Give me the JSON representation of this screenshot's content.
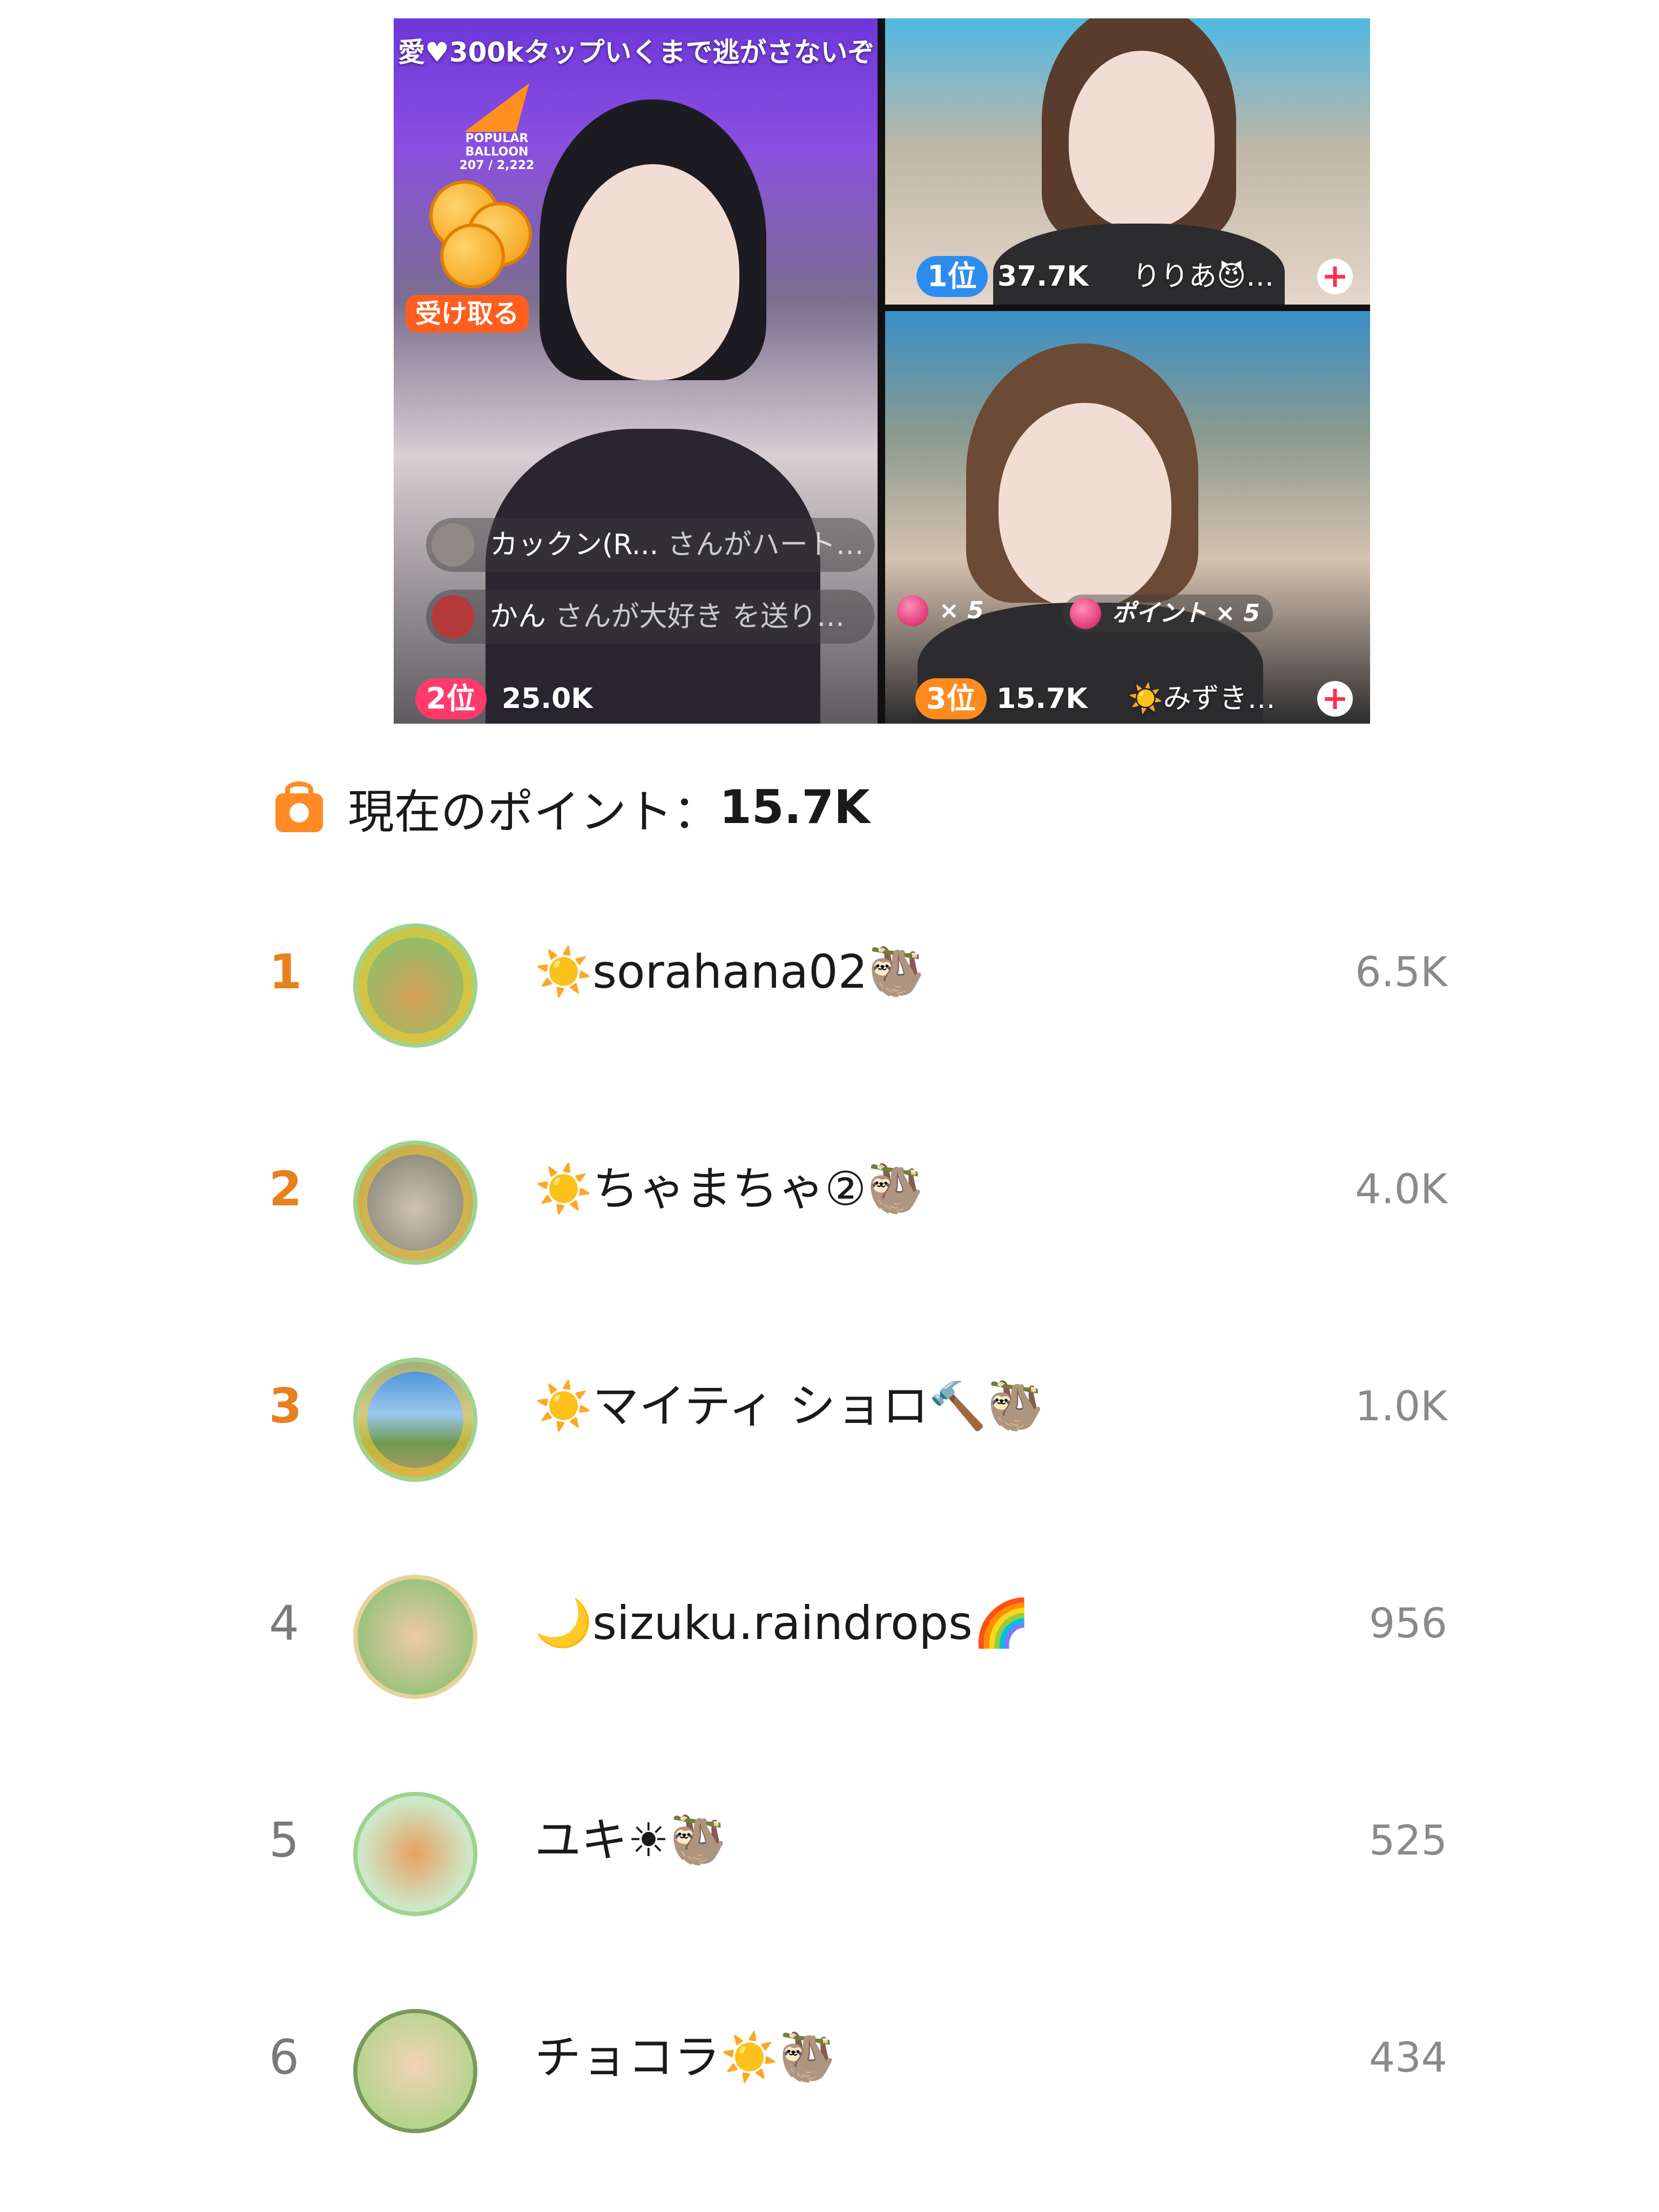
{
  "stream": {
    "banner": "愛♥300kタップいくまで逃がさないぞ",
    "balloon_title": "POPULAR BALLOON",
    "balloon_progress": "207 / 2,222",
    "receive_button": "受け取る",
    "comments": [
      {
        "user": "カックン(R...",
        "text": "さんがハート…"
      },
      {
        "user": "かん",
        "text": "さんが大好き を送り…"
      }
    ],
    "gift_multiplier": "× 5",
    "gift_points": "ポイント × 5"
  },
  "guests": [
    {
      "rank": "1位",
      "score": "37.7K",
      "name": "りりあ😈…",
      "rank_color": "#2d8cf0"
    },
    {
      "rank": "2位",
      "score": "25.0K",
      "rank_color": "#ff3b6b"
    },
    {
      "rank": "3位",
      "score": "15.7K",
      "name": "☀️みずき…",
      "rank_color": "#ff8a1f"
    }
  ],
  "points": {
    "label": "現在のポイント：",
    "value": "15.7K",
    "icon": "gift-icon"
  },
  "leaderboard": [
    {
      "rank": "1",
      "name": "☀️sorahana02🦥",
      "score": "6.5K"
    },
    {
      "rank": "2",
      "name": "☀️ちゃまちゃ②🦥",
      "score": "4.0K"
    },
    {
      "rank": "3",
      "name": "☀️マイティ ショロ🔨🦥",
      "score": "1.0K"
    },
    {
      "rank": "4",
      "name": "🌙sizuku.raindrops🌈",
      "score": "956"
    },
    {
      "rank": "5",
      "name": "ユキ☀🦥",
      "score": "525"
    },
    {
      "rank": "6",
      "name": "チョコラ☀️🦥",
      "score": "434"
    }
  ],
  "colors": {
    "top_rank": "#e8801e",
    "normal_rank": "#7a7a7a",
    "score": "#8a8a8a",
    "avatar_border": "#9ed38e"
  }
}
